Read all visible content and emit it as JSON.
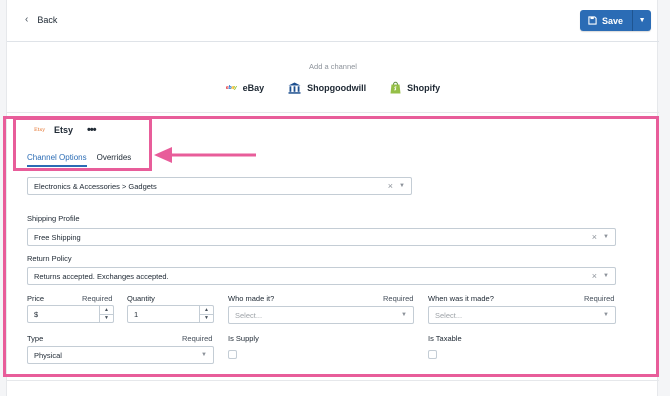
{
  "header": {
    "back_label": "Back",
    "save_label": "Save"
  },
  "channels": {
    "add_label": "Add a channel",
    "items": [
      {
        "name": "eBay",
        "logo_text": "ebay",
        "icon": "ebay-logo"
      },
      {
        "name": "Shopgoodwill",
        "icon": "shopgoodwill-building-icon"
      },
      {
        "name": "Shopify",
        "icon": "shopify-bag-icon"
      }
    ]
  },
  "etsy": {
    "logo_text": "Etsy",
    "name": "Etsy",
    "more_icon": "more-dots-icon",
    "tabs": [
      {
        "label": "Channel Options",
        "active": true
      },
      {
        "label": "Overrides",
        "active": false
      }
    ]
  },
  "form": {
    "category": {
      "value": "Electronics & Accessories > Gadgets"
    },
    "shipping_profile": {
      "label": "Shipping Profile",
      "value": "Free Shipping"
    },
    "return_policy": {
      "label": "Return Policy",
      "value": "Returns accepted. Exchanges accepted."
    },
    "price": {
      "label": "Price",
      "required": "Required",
      "prefix": "$",
      "value": ""
    },
    "quantity": {
      "label": "Quantity",
      "value": "1"
    },
    "who_made": {
      "label": "Who made it?",
      "required": "Required",
      "placeholder": "Select..."
    },
    "when_made": {
      "label": "When was it made?",
      "required": "Required",
      "placeholder": "Select..."
    },
    "type": {
      "label": "Type",
      "required": "Required",
      "value": "Physical"
    },
    "is_supply": {
      "label": "Is Supply",
      "checked": false
    },
    "is_taxable": {
      "label": "Is Taxable",
      "checked": false
    }
  },
  "colors": {
    "accent": "#2b6cb5",
    "highlight": "#e85d9a",
    "etsy_orange": "#e36a1f"
  }
}
